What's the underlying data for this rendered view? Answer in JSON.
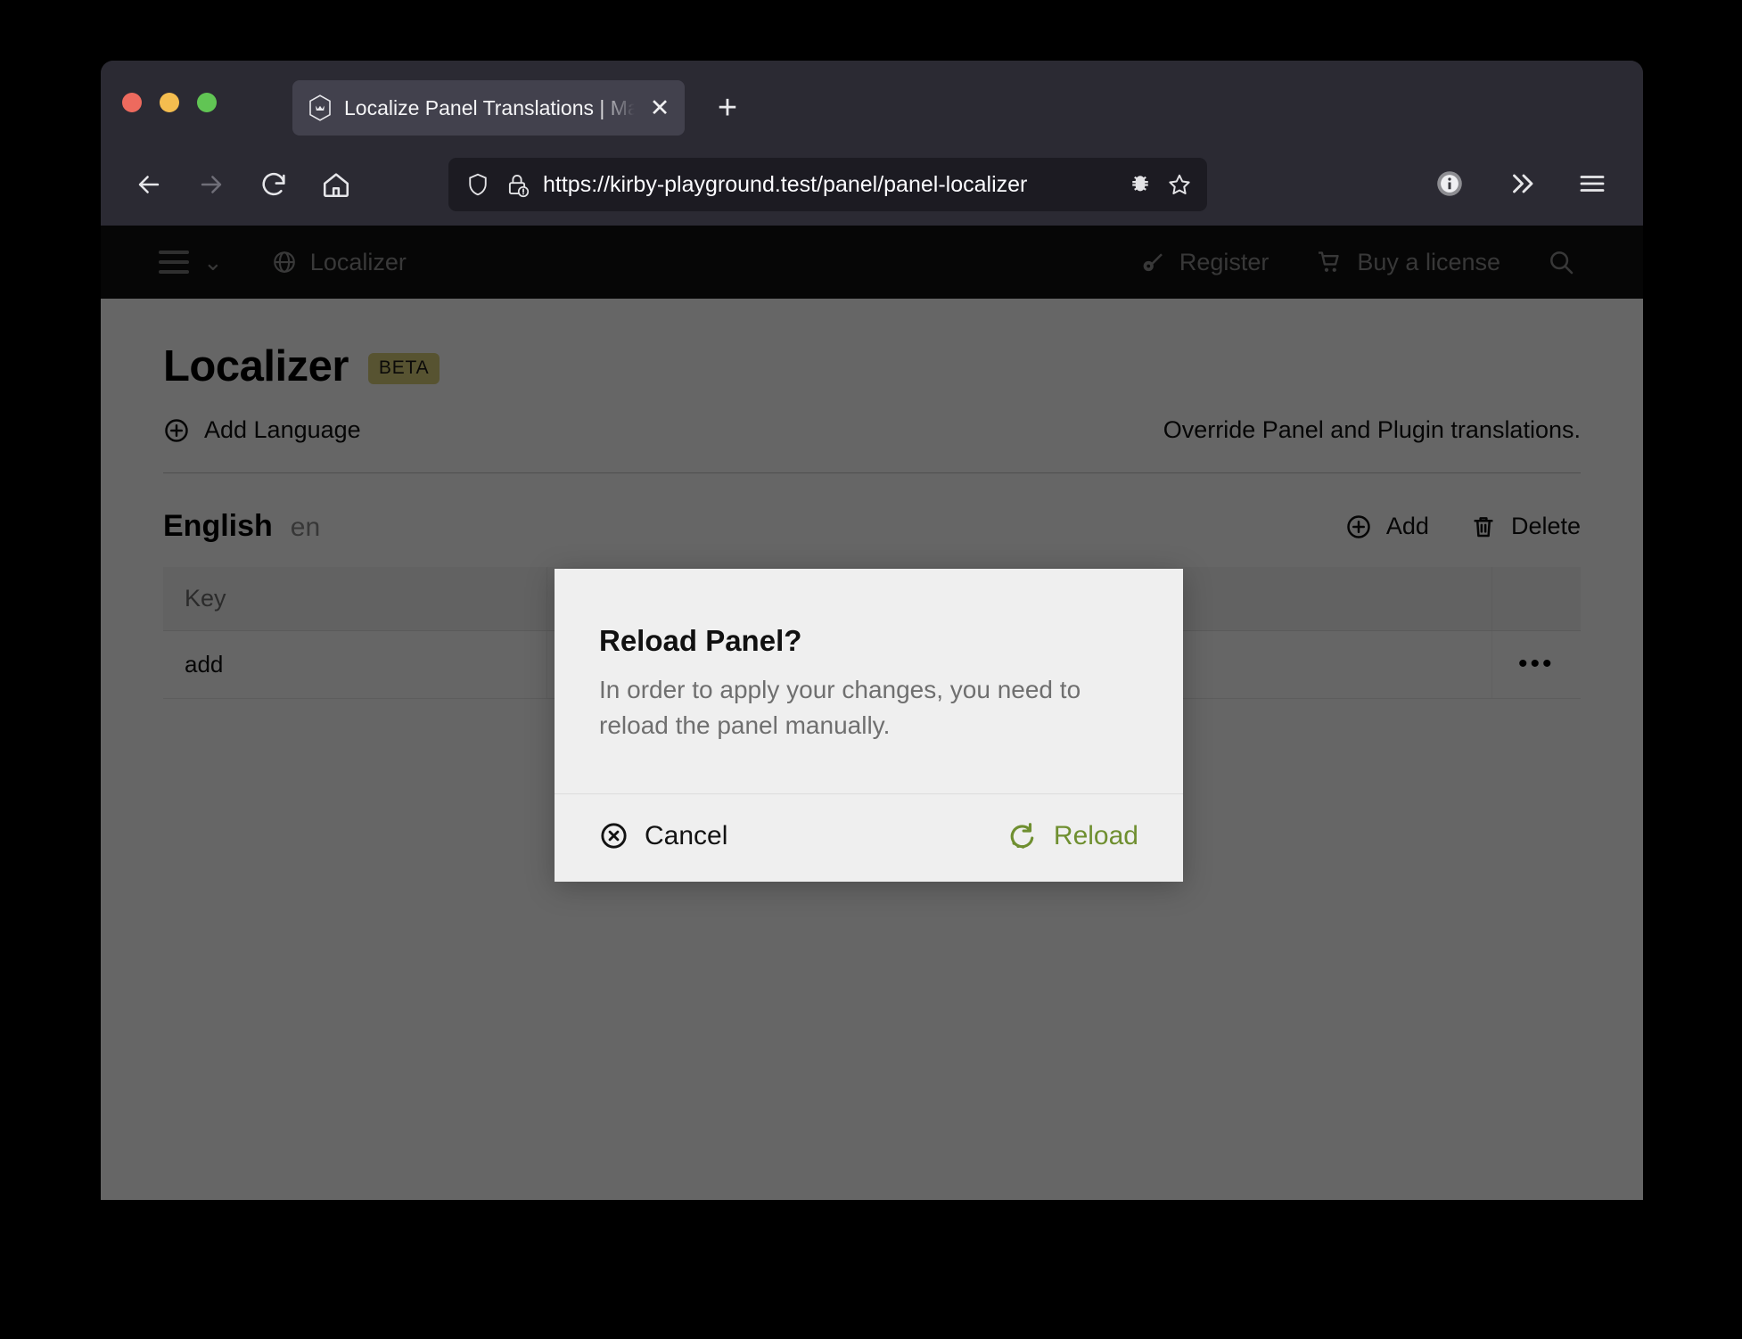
{
  "browser": {
    "tab": {
      "title": "Localize Panel Translations | Ma",
      "favicon_name": "kirby-hexagon-icon",
      "close_label": "✕"
    },
    "new_tab_label": "+",
    "nav": {
      "back_icon": "arrow-left-icon",
      "forward_icon": "arrow-right-icon",
      "reload_icon": "reload-icon",
      "home_icon": "home-icon"
    },
    "url": "https://kirby-playground.test/panel/panel-localizer",
    "url_icons": [
      "shield-icon",
      "lock-warning-icon"
    ],
    "toolbar_right": [
      "bug-icon",
      "star-bookmark-icon",
      "account-icon",
      "chevron-double-right-icon",
      "app-menu-icon"
    ]
  },
  "panel_topbar": {
    "menu_icon": "hamburger-icon",
    "menu_caret": "⌄",
    "brand_icon": "globe-icon",
    "brand": "Localizer",
    "items": [
      {
        "icon": "key-icon",
        "label": "Register"
      },
      {
        "icon": "cart-icon",
        "label": "Buy a license"
      }
    ],
    "search_icon": "search-icon"
  },
  "main": {
    "title": "Localizer",
    "badge": "BETA",
    "add_language": {
      "icon": "circle-plus-icon",
      "label": "Add Language"
    },
    "note": "Override Panel and Plugin translations.",
    "language": {
      "name": "English",
      "code": "en",
      "actions": [
        {
          "icon": "circle-plus-icon",
          "label": "Add"
        },
        {
          "icon": "trash-icon",
          "label": "Delete"
        }
      ]
    },
    "table": {
      "columns": [
        "Key",
        "",
        ""
      ],
      "rows": [
        {
          "key": "add",
          "value": "",
          "options": "•••"
        }
      ]
    }
  },
  "dialog": {
    "title": "Reload Panel?",
    "text": "In order to apply your changes, you need to reload the panel manually.",
    "cancel": {
      "icon": "circle-x-icon",
      "label": "Cancel"
    },
    "confirm": {
      "icon": "rotate-ccw-icon",
      "label": "Reload"
    }
  },
  "colors": {
    "accent_green": "#6f8f30",
    "beta_badge": "#d9cf7a",
    "browser_chrome": "#2b2a33",
    "urlbar": "#1c1b22",
    "panel_topbar": "#100f11"
  }
}
